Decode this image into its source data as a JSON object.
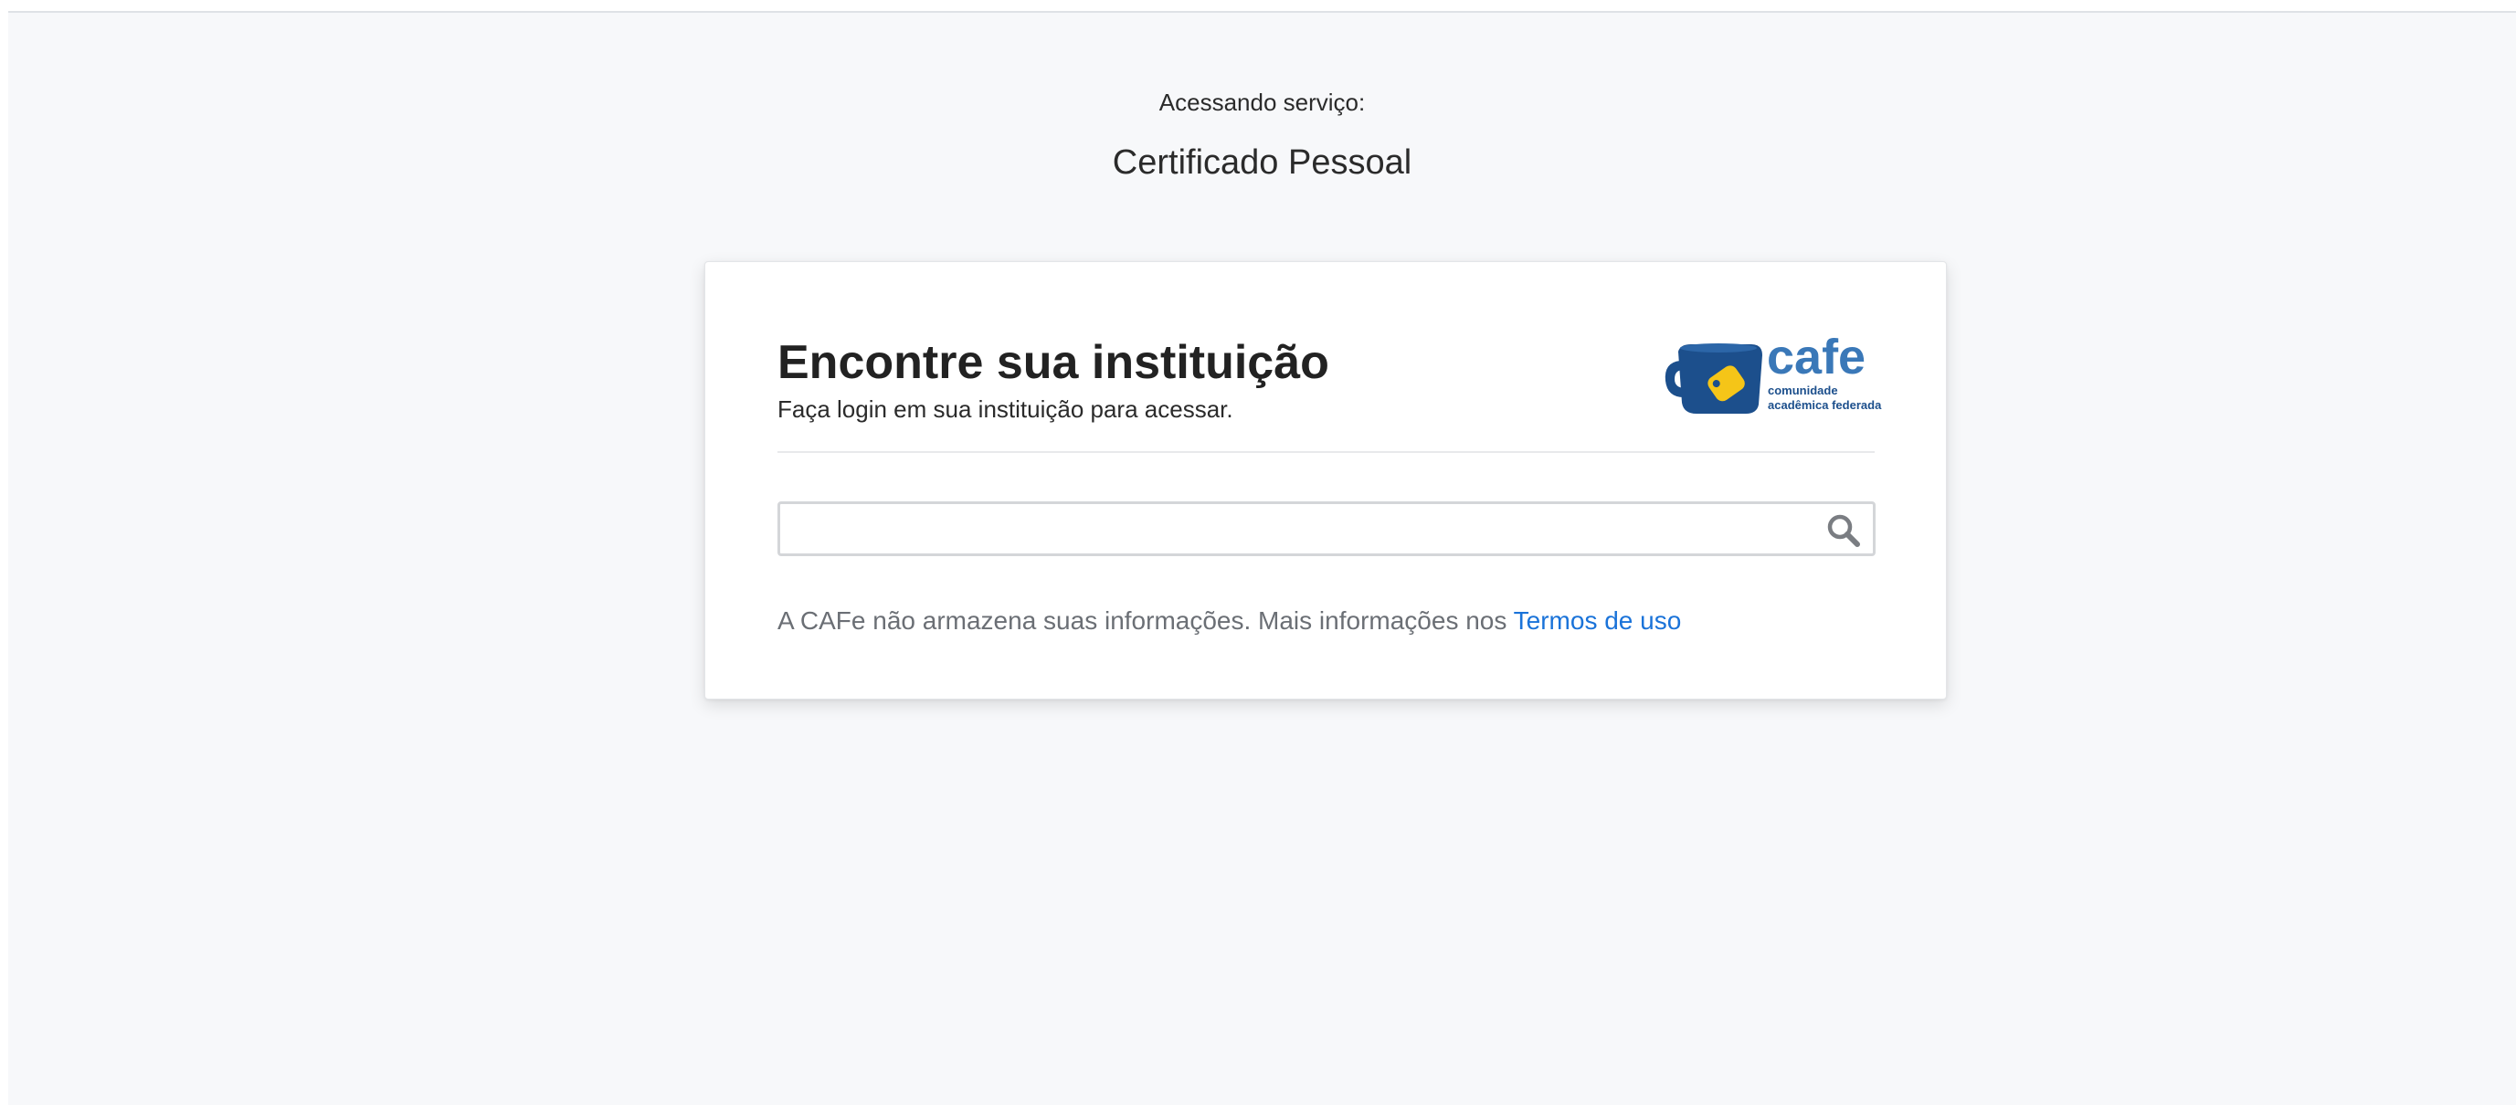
{
  "header": {
    "service_label": "Acessando serviço:",
    "service_name": "Certificado Pessoal"
  },
  "card": {
    "title": "Encontre sua instituição",
    "subtitle": "Faça login em sua instituição para acessar.",
    "logo": {
      "icon": "cafe-mug-logo",
      "wordmark": "cafe",
      "tagline_line1": "comunidade",
      "tagline_line2": "acadêmica federada"
    },
    "search": {
      "value": "",
      "placeholder": "",
      "icon": "search-icon"
    },
    "disclaimer_text": "A CAFe não armazena suas informações. Mais informações nos ",
    "terms_link": "Termos de uso"
  },
  "colors": {
    "background": "#f7f8fa",
    "logo_blue": "#1c4f8c",
    "logo_light_blue": "#3a78b8",
    "logo_yellow": "#f5c518",
    "link": "#1a73d9"
  }
}
